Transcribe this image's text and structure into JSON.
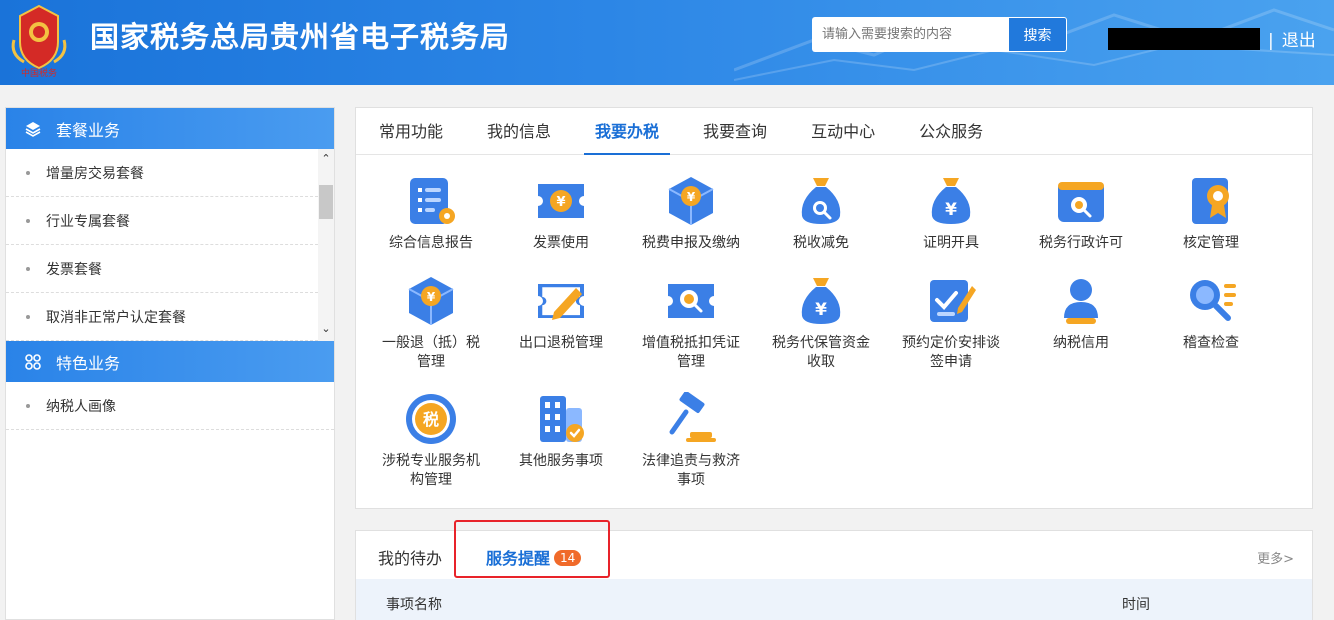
{
  "header": {
    "title": "国家税务总局贵州省电子税务局",
    "search_placeholder": "请输入需要搜索的内容",
    "search_label": "搜索",
    "separator": "|",
    "logout_label": "退出"
  },
  "sidebar": {
    "groups": [
      {
        "title": "套餐业务",
        "icon": "layers-icon",
        "items": [
          "增量房交易套餐",
          "行业专属套餐",
          "发票套餐",
          "取消非正常户认定套餐"
        ]
      },
      {
        "title": "特色业务",
        "icon": "grid-circles-icon",
        "items": [
          "纳税人画像"
        ]
      }
    ],
    "scroll_up": "⌃",
    "scroll_down": "⌄"
  },
  "main": {
    "tabs": [
      "常用功能",
      "我的信息",
      "我要办税",
      "我要查询",
      "互动中心",
      "公众服务"
    ],
    "active_tab": "我要办税",
    "items": [
      {
        "label": "综合信息报告",
        "icon": "report-gear-icon"
      },
      {
        "label": "发票使用",
        "icon": "invoice-ticket-icon"
      },
      {
        "label": "税费申报及缴纳",
        "icon": "tax-cube-icon"
      },
      {
        "label": "税收减免",
        "icon": "money-bag-search-icon"
      },
      {
        "label": "证明开具",
        "icon": "money-bag-yen-icon"
      },
      {
        "label": "税务行政许可",
        "icon": "window-search-icon"
      },
      {
        "label": "核定管理",
        "icon": "document-badge-icon"
      },
      {
        "label": "一般退（抵）税管理",
        "icon": "refund-cube-icon"
      },
      {
        "label": "出口退税管理",
        "icon": "edit-card-icon"
      },
      {
        "label": "增值税抵扣凭证管理",
        "icon": "ticket-search-icon"
      },
      {
        "label": "税务代保管资金收取",
        "icon": "money-bag-icon"
      },
      {
        "label": "预约定价安排谈签申请",
        "icon": "checklist-pen-icon"
      },
      {
        "label": "纳税信用",
        "icon": "user-credit-icon"
      },
      {
        "label": "稽查检查",
        "icon": "magnifier-list-icon"
      },
      {
        "label": "涉税专业服务机构管理",
        "icon": "tax-seal-icon"
      },
      {
        "label": "其他服务事项",
        "icon": "building-check-icon"
      },
      {
        "label": "法律追责与救济事项",
        "icon": "gavel-icon"
      }
    ]
  },
  "bottom": {
    "tabs": [
      "我的待办",
      "服务提醒"
    ],
    "active_tab": "服务提醒",
    "badge_count": "14",
    "more_label": "更多>",
    "columns": [
      "事项名称",
      "时间"
    ]
  },
  "colors": {
    "brand_blue": "#1a6fd6",
    "badge_orange": "#f06a2a",
    "highlight_red": "#e8232a"
  }
}
